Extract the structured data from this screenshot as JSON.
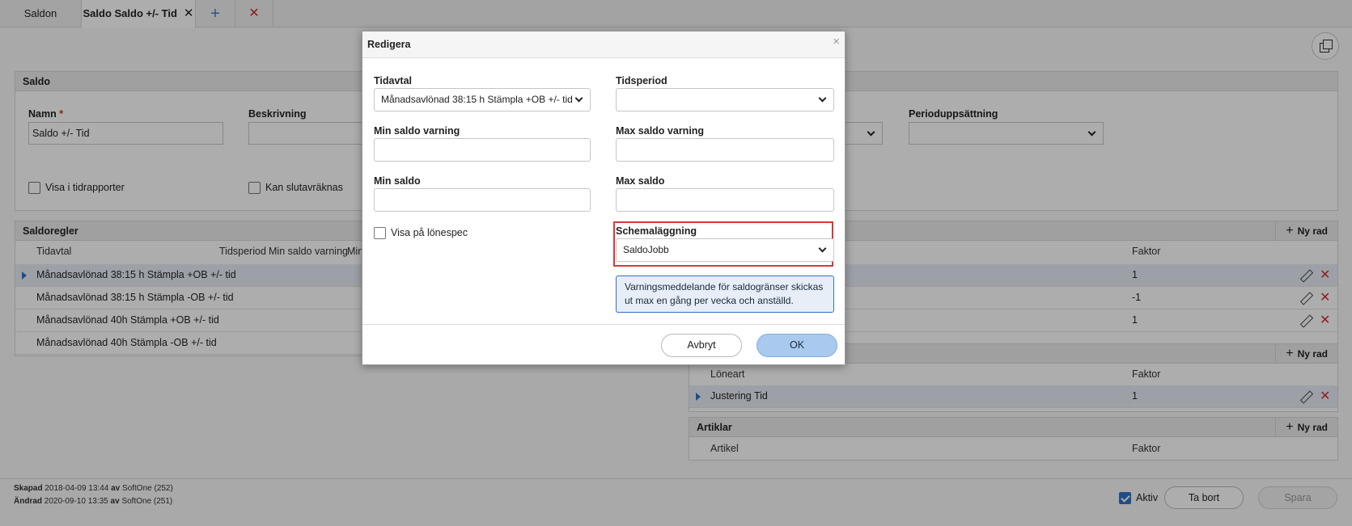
{
  "tabs": [
    {
      "label": "Saldon"
    },
    {
      "label": "Saldo Saldo +/- Tid"
    }
  ],
  "saldo": {
    "title": "Saldo",
    "name_label": "Namn",
    "name_value": "Saldo +/- Tid",
    "desc_label": "Beskrivning",
    "period_label": "Perioduppsättning",
    "cb_tidrapporter": "Visa i tidrapporter",
    "cb_slutavrakna": "Kan slutavräknas"
  },
  "saldoregler": {
    "title": "Saldoregler",
    "new_row": "Ny rad",
    "headers": [
      "Tidavtal",
      "Tidsperiod",
      "Min saldo varning",
      "Min"
    ],
    "rows": [
      "Månadsavlönad 38:15 h Stämpla +OB +/- tid",
      "Månadsavlönad 38:15 h Stämpla -OB +/- tid",
      "Månadsavlönad 40h Stämpla +OB +/- tid",
      "Månadsavlönad 40h Stämpla -OB +/- tid"
    ]
  },
  "right_grid1": {
    "faktor_header": "Faktor",
    "faktor_values": [
      "1",
      "-1",
      "1"
    ]
  },
  "loneart": {
    "new_row": "Ny rad",
    "col1": "Löneart",
    "col2": "Faktor",
    "row_name": "Justering Tid",
    "row_faktor": "1"
  },
  "artiklar": {
    "title": "Artiklar",
    "new_row": "Ny rad",
    "col1": "Artikel",
    "col2": "Faktor"
  },
  "footer": {
    "created_label": "Skapad",
    "created_value": "2018-04-09 13:44",
    "created_by_label": "av",
    "created_by": "SoftOne (252)",
    "changed_label": "Ändrad",
    "changed_value": "2020-09-10 13:35",
    "changed_by_label": "av",
    "changed_by": "SoftOne (251)",
    "aktiv_label": "Aktiv",
    "delete_label": "Ta bort",
    "save_label": "Spara"
  },
  "modal": {
    "title": "Redigera",
    "tidavtal_label": "Tidavtal",
    "tidavtal_value": "Månadsavlönad 38:15 h Stämpla +OB +/- tid",
    "tidsperiod_label": "Tidsperiod",
    "tidsperiod_value": "",
    "min_warn_label": "Min saldo varning",
    "max_warn_label": "Max saldo varning",
    "min_label": "Min saldo",
    "max_label": "Max saldo",
    "lonespec_label": "Visa på lönespec",
    "schema_label": "Schemaläggning",
    "schema_value": "SaldoJobb",
    "info_text": "Varningsmeddelande för saldogränser skickas ut max en gång per vecka och anställd.",
    "cancel_label": "Avbryt",
    "ok_label": "OK"
  },
  "colors": {
    "accent": "#2f73c5",
    "highlight": "#d9363e",
    "ok_button": "#a9c9ee",
    "info_bg": "#e7eef7"
  }
}
